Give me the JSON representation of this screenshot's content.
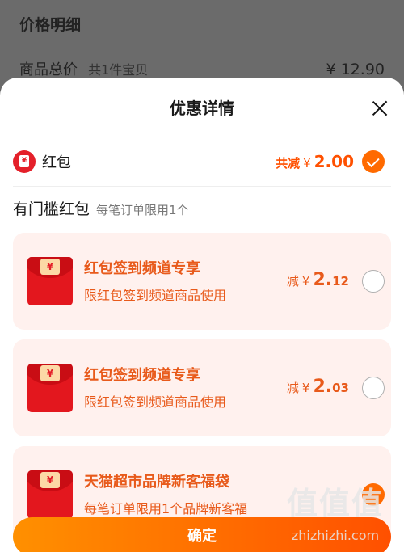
{
  "background": {
    "title": "价格明细",
    "row_label": "商品总价",
    "row_sub": "共1件宝贝",
    "row_value": "¥ 12.90"
  },
  "sheet": {
    "title": "优惠详情",
    "close_icon": "close-icon"
  },
  "hongbao": {
    "icon": "red-envelope-icon",
    "label": "红包",
    "total_prefix": "共减",
    "currency": "¥",
    "total_amount": "2.00",
    "selected": true
  },
  "section": {
    "title": "有门槛红包",
    "subtitle": "每笔订单限用1个"
  },
  "coupons": [
    {
      "title": "红包签到频道专享",
      "desc": "限红包签到频道商品使用",
      "prefix": "减",
      "currency": "¥",
      "int": "2.",
      "dec": "12",
      "selected": false
    },
    {
      "title": "红包签到频道专享",
      "desc": "限红包签到频道商品使用",
      "prefix": "减",
      "currency": "¥",
      "int": "2.",
      "dec": "03",
      "selected": false
    },
    {
      "title": "天猫超市品牌新客福袋",
      "desc": "每笔订单限用1个品牌新客福",
      "selected": true
    }
  ],
  "confirm_label": "确定",
  "watermark": {
    "mark": "值值值",
    "site": "zhizhizhi.com"
  },
  "colors": {
    "accent": "#ff5000",
    "card_bg": "#fff1ee",
    "envelope": "#e3171e"
  }
}
